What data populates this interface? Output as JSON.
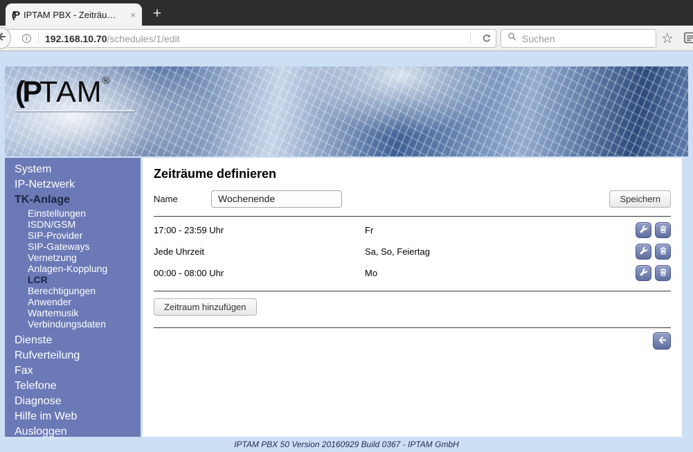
{
  "browser": {
    "tab": {
      "favicon_text": "(P",
      "title": "IPTAM PBX - Zeiträu…",
      "close_glyph": "×"
    },
    "new_tab_glyph": "+",
    "url": {
      "host": "192.168.10.70",
      "path": "/schedules/1/edit"
    },
    "search": {
      "placeholder": "Suchen"
    },
    "star_glyph": "☆"
  },
  "banner": {
    "logo_lp": "(P",
    "logo_tam": "TAM",
    "logo_reg": "®"
  },
  "sidebar": {
    "items": [
      {
        "label": "System",
        "style": "top"
      },
      {
        "label": "IP-Netzwerk",
        "style": "top"
      },
      {
        "label": "TK-Anlage",
        "style": "top active"
      },
      {
        "label": "Einstellungen",
        "style": "sub"
      },
      {
        "label": "ISDN/GSM",
        "style": "sub"
      },
      {
        "label": "SIP-Provider",
        "style": "sub"
      },
      {
        "label": "SIP-Gateways",
        "style": "sub"
      },
      {
        "label": "Vernetzung",
        "style": "sub"
      },
      {
        "label": "Anlagen-Kopplung",
        "style": "sub"
      },
      {
        "label": "LCR",
        "style": "sub active"
      },
      {
        "label": "Berechtigungen",
        "style": "sub"
      },
      {
        "label": "Anwender",
        "style": "sub"
      },
      {
        "label": "Wartemusik",
        "style": "sub"
      },
      {
        "label": "Verbindungsdaten",
        "style": "sub"
      },
      {
        "label": "Dienste",
        "style": "top"
      },
      {
        "label": "Rufverteilung",
        "style": "top"
      },
      {
        "label": "Fax",
        "style": "top"
      },
      {
        "label": "Telefone",
        "style": "top"
      },
      {
        "label": "Diagnose",
        "style": "top"
      },
      {
        "label": "Hilfe im Web",
        "style": "top"
      },
      {
        "label": "Ausloggen",
        "style": "top"
      }
    ]
  },
  "main": {
    "title": "Zeiträume definieren",
    "name_label": "Name",
    "name_value": "Wochenende",
    "save_label": "Speichern",
    "rows": [
      {
        "time": "17:00 - 23:59 Uhr",
        "days": "Fr"
      },
      {
        "time": "Jede Uhrzeit",
        "days": "Sa, So, Feiertag"
      },
      {
        "time": "00:00 - 08:00 Uhr",
        "days": "Mo"
      }
    ],
    "add_label": "Zeitraum hinzufügen"
  },
  "footer": {
    "text": "IPTAM PBX 50 Version 20160929 Build 0367 - IPTAM GmbH"
  },
  "colors": {
    "sidebar": "#6b79b6",
    "page_bg": "#cddff5",
    "icon_button": "#5f6e9e"
  }
}
